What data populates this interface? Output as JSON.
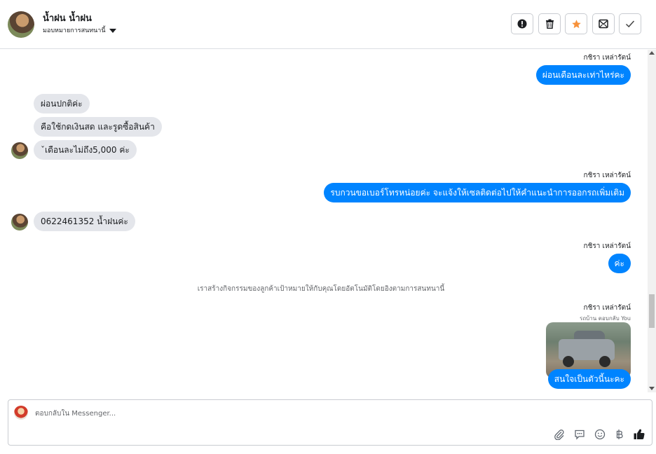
{
  "header": {
    "contact_name": "น้ำฝน น้ำฝน",
    "assign_label": "มอบหมายการสนทนานี้",
    "actions": [
      {
        "icon": "exclamation-circle-icon"
      },
      {
        "icon": "trash-icon"
      },
      {
        "icon": "star-icon",
        "color": "#f7923b"
      },
      {
        "icon": "mark-unread-icon"
      },
      {
        "icon": "check-icon"
      }
    ]
  },
  "messages": {
    "m1_sender": "กชิรา เหล่ารัตน์",
    "m1_text": "ผ่อนเดือนละเท่าไหร่คะ",
    "m2_text": "ผ่อนปกติค่ะ",
    "m3_text": "คือใช้กดเงินสด และรูดซื้อสินค้า",
    "m4_text": "ˇเดือนละไม่ถึง5,000 ค่ะ",
    "m5_sender": "กชิรา เหล่ารัตน์",
    "m5_text": "รบกวนขอเบอร์โทรหน่อยค่ะ จะแจ้งให้เซลติดต่อไปให้คำแนะนำการออกรถเพิ่มเติม",
    "m6_text": "0622461352 น้ำฝนค่ะ",
    "m7_sender": "กชิรา เหล่ารัตน์",
    "m7_text": "ค่ะ",
    "system_note": "เราสร้างกิจกรรมของลูกค้าเป้าหมายให้กับคุณโดยอัตโนมัติโดยอิงตามการสนทนานี้",
    "m8_sender": "กชิรา เหล่ารัตน์",
    "m8_reply_label": "รถบ้าน ตอบกลับ You",
    "m8_text": "สนใจเป็นตัวนี้นะคะ"
  },
  "composer": {
    "placeholder": "ตอบกลับใน Messenger...",
    "icons": [
      "attachment-icon",
      "saved-replies-icon",
      "emoji-icon",
      "baht-icon",
      "like-icon"
    ]
  },
  "colors": {
    "accent": "#0084ff",
    "incoming_bubble": "#e4e6eb"
  }
}
